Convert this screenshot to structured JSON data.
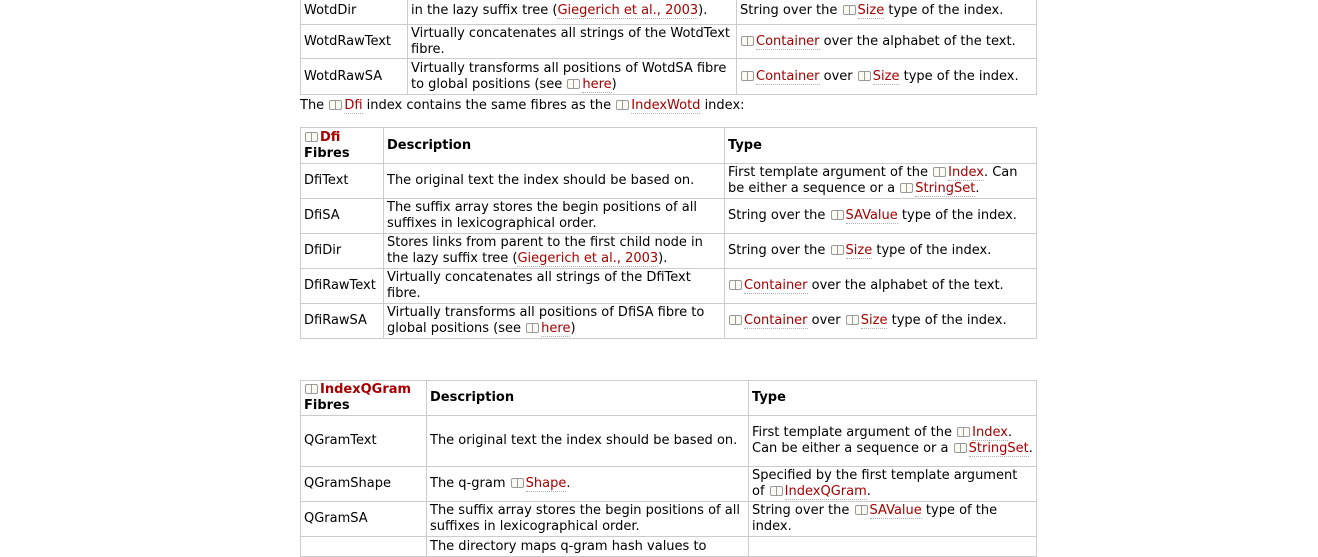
{
  "table_top": {
    "rows": [
      {
        "name": "WotdDir",
        "desc": [
          "in the lazy suffix tree (",
          {
            "link": "Giegerich et al., 2003"
          },
          ")."
        ],
        "type": [
          "String over the ",
          {
            "link": "Size",
            "icon": true
          },
          " type of the index."
        ]
      },
      {
        "name": "WotdRawText",
        "desc": [
          "Virtually concatenates all strings of the WotdText fibre."
        ],
        "type": [
          {
            "link": "Container",
            "icon": true
          },
          " over the alphabet of the text."
        ]
      },
      {
        "name": "WotdRawSA",
        "desc": [
          "Virtually transforms all positions of WotdSA fibre to global positions (see ",
          {
            "link": "here",
            "icon": true
          },
          ")"
        ],
        "type": [
          {
            "link": "Container",
            "icon": true
          },
          " over ",
          {
            "link": "Size",
            "icon": true
          },
          " type of the index."
        ]
      }
    ]
  },
  "paragraph": [
    "The ",
    {
      "link": "Dfi",
      "icon": true
    },
    " index contains the same fibres as the ",
    {
      "link": "IndexWotd",
      "icon": true
    },
    " index:"
  ],
  "table_dfi": {
    "header_link": "Dfi",
    "header_suffix": "Fibres",
    "col_description": "Description",
    "col_type": "Type",
    "rows": [
      {
        "name": "DfiText",
        "desc": [
          "The original text the index should be based on."
        ],
        "type": [
          "First template argument of the ",
          {
            "link": "Index",
            "icon": true
          },
          ". Can be either a sequence or a ",
          {
            "link": "StringSet",
            "icon": true
          },
          "."
        ]
      },
      {
        "name": "DfiSA",
        "desc": [
          "The suffix array stores the begin positions of all suffixes in lexicographical order."
        ],
        "type": [
          "String over the ",
          {
            "link": "SAValue",
            "icon": true
          },
          " type of the index."
        ]
      },
      {
        "name": "DfiDir",
        "desc": [
          "Stores links from parent to the first child node in the lazy suffix tree (",
          {
            "link": "Giegerich et al., 2003"
          },
          ")."
        ],
        "type": [
          "String over the ",
          {
            "link": "Size",
            "icon": true
          },
          " type of the index."
        ]
      },
      {
        "name": "DfiRawText",
        "desc": [
          "Virtually concatenates all strings of the DfiText fibre."
        ],
        "type": [
          {
            "link": "Container",
            "icon": true
          },
          " over the alphabet of the text."
        ]
      },
      {
        "name": "DfiRawSA",
        "desc": [
          "Virtually transforms all positions of DfiSA fibre to global positions (see ",
          {
            "link": "here",
            "icon": true
          },
          ")"
        ],
        "type": [
          {
            "link": "Container",
            "icon": true
          },
          " over ",
          {
            "link": "Size",
            "icon": true
          },
          " type of the index."
        ]
      }
    ]
  },
  "table_qgram": {
    "header_link": "IndexQGram",
    "header_suffix": "Fibres",
    "col_description": "Description",
    "col_type": "Type",
    "rows": [
      {
        "name": "QGramText",
        "desc": [
          "The original text the index should be based on."
        ],
        "type": [
          "First template argument of the ",
          {
            "link": "Index",
            "icon": true
          },
          ". Can be either a sequence or a ",
          {
            "link": "StringSet",
            "icon": true
          },
          "."
        ]
      },
      {
        "name": "QGramShape",
        "desc": [
          "The q-gram ",
          {
            "link": "Shape",
            "icon": true
          },
          "."
        ],
        "type": [
          "Specified by the first template argument of ",
          {
            "link": "IndexQGram",
            "icon": true
          },
          "."
        ]
      },
      {
        "name": "QGramSA",
        "desc": [
          "The suffix array stores the begin positions of all suffixes in lexicographical order."
        ],
        "type": [
          "String over the ",
          {
            "link": "SAValue",
            "icon": true
          },
          " type of the index."
        ]
      },
      {
        "name": "",
        "desc": [
          "The directory maps q-gram hash values to"
        ],
        "type": [
          ""
        ]
      }
    ]
  },
  "colors": {
    "link": "#a60000",
    "border": "#cccccc",
    "text": "#000000"
  }
}
